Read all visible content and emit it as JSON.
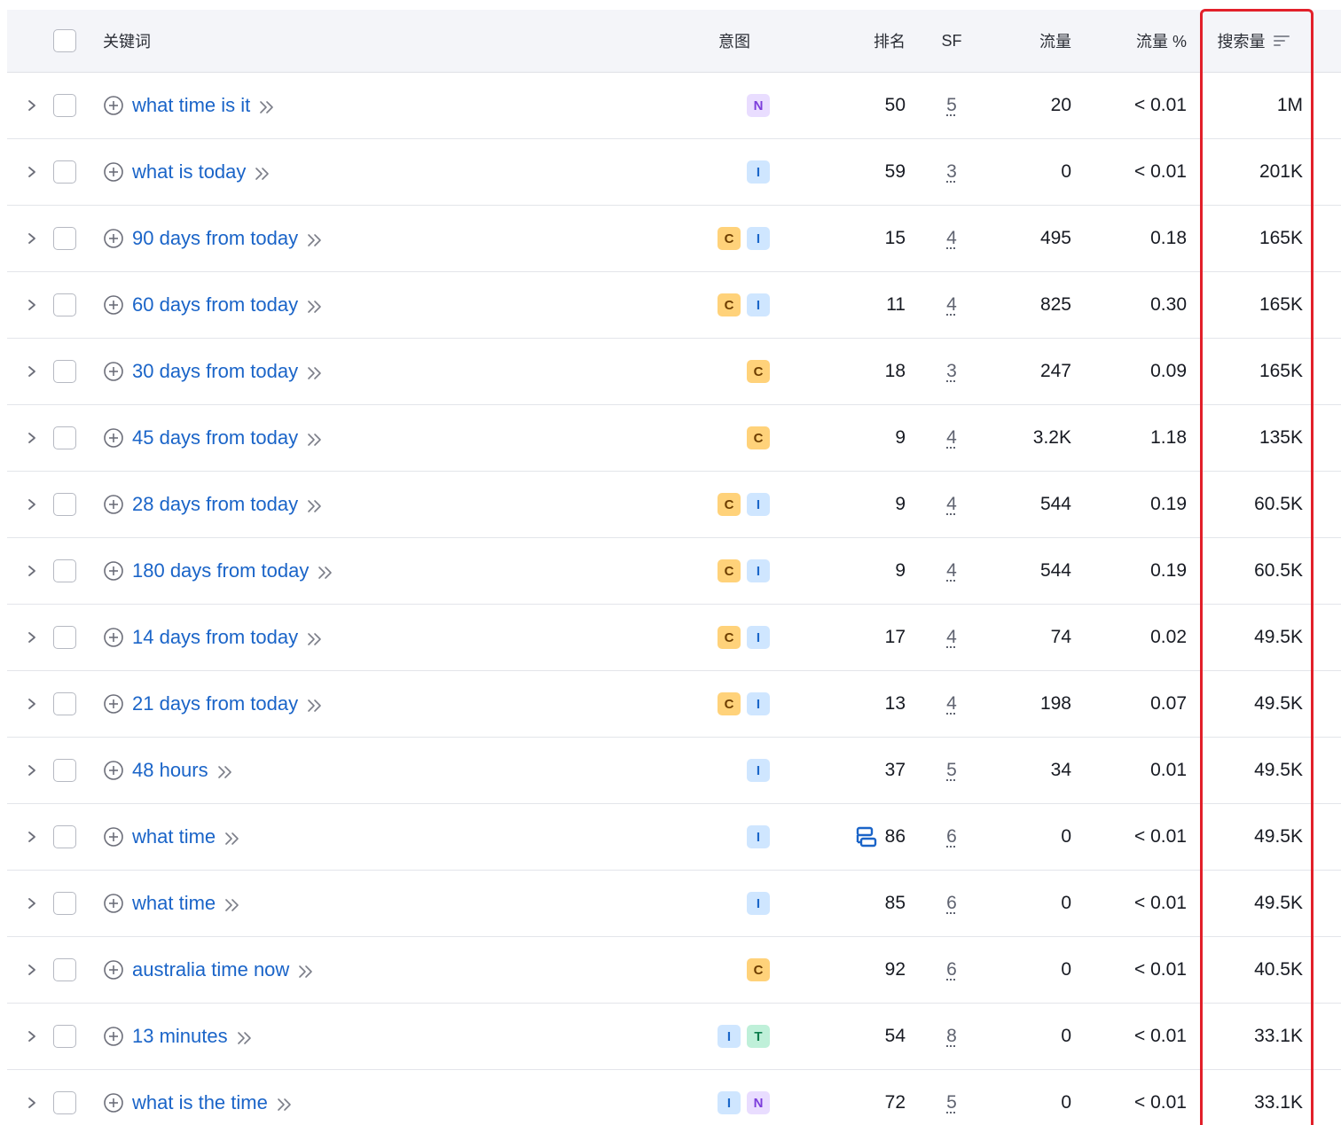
{
  "header": {
    "keyword": "关键词",
    "intent": "意图",
    "position": "排名",
    "sf": "SF",
    "traffic": "流量",
    "traffic_pct": "流量 %",
    "volume": "搜索量"
  },
  "icons": {
    "expand": "chevron-right-icon",
    "add": "plus-circle-icon",
    "open": "double-chevron-right-icon",
    "sort": "sort-descending-icon",
    "feature": "serp-feature-icon"
  },
  "colors": {
    "link": "#1a64c8",
    "highlight": "#e2202a",
    "header_bg": "#f4f5f9"
  },
  "rows": [
    {
      "keyword": "what time is it",
      "intents": [
        "N"
      ],
      "position": "50",
      "sf": "5",
      "traffic": "20",
      "traffic_pct": "< 0.01",
      "volume": "1M",
      "feature": false
    },
    {
      "keyword": "what is today",
      "intents": [
        "I"
      ],
      "position": "59",
      "sf": "3",
      "traffic": "0",
      "traffic_pct": "< 0.01",
      "volume": "201K",
      "feature": false
    },
    {
      "keyword": "90 days from today",
      "intents": [
        "C",
        "I"
      ],
      "position": "15",
      "sf": "4",
      "traffic": "495",
      "traffic_pct": "0.18",
      "volume": "165K",
      "feature": false
    },
    {
      "keyword": "60 days from today",
      "intents": [
        "C",
        "I"
      ],
      "position": "11",
      "sf": "4",
      "traffic": "825",
      "traffic_pct": "0.30",
      "volume": "165K",
      "feature": false
    },
    {
      "keyword": "30 days from today",
      "intents": [
        "C"
      ],
      "position": "18",
      "sf": "3",
      "traffic": "247",
      "traffic_pct": "0.09",
      "volume": "165K",
      "feature": false
    },
    {
      "keyword": "45 days from today",
      "intents": [
        "C"
      ],
      "position": "9",
      "sf": "4",
      "traffic": "3.2K",
      "traffic_pct": "1.18",
      "volume": "135K",
      "feature": false
    },
    {
      "keyword": "28 days from today",
      "intents": [
        "C",
        "I"
      ],
      "position": "9",
      "sf": "4",
      "traffic": "544",
      "traffic_pct": "0.19",
      "volume": "60.5K",
      "feature": false
    },
    {
      "keyword": "180 days from today",
      "intents": [
        "C",
        "I"
      ],
      "position": "9",
      "sf": "4",
      "traffic": "544",
      "traffic_pct": "0.19",
      "volume": "60.5K",
      "feature": false
    },
    {
      "keyword": "14 days from today",
      "intents": [
        "C",
        "I"
      ],
      "position": "17",
      "sf": "4",
      "traffic": "74",
      "traffic_pct": "0.02",
      "volume": "49.5K",
      "feature": false
    },
    {
      "keyword": "21 days from today",
      "intents": [
        "C",
        "I"
      ],
      "position": "13",
      "sf": "4",
      "traffic": "198",
      "traffic_pct": "0.07",
      "volume": "49.5K",
      "feature": false
    },
    {
      "keyword": "48 hours",
      "intents": [
        "I"
      ],
      "position": "37",
      "sf": "5",
      "traffic": "34",
      "traffic_pct": "0.01",
      "volume": "49.5K",
      "feature": false
    },
    {
      "keyword": "what time",
      "intents": [
        "I"
      ],
      "position": "86",
      "sf": "6",
      "traffic": "0",
      "traffic_pct": "< 0.01",
      "volume": "49.5K",
      "feature": true
    },
    {
      "keyword": "what time",
      "intents": [
        "I"
      ],
      "position": "85",
      "sf": "6",
      "traffic": "0",
      "traffic_pct": "< 0.01",
      "volume": "49.5K",
      "feature": false
    },
    {
      "keyword": "australia time now",
      "intents": [
        "C"
      ],
      "position": "92",
      "sf": "6",
      "traffic": "0",
      "traffic_pct": "< 0.01",
      "volume": "40.5K",
      "feature": false
    },
    {
      "keyword": "13 minutes",
      "intents": [
        "I",
        "T"
      ],
      "position": "54",
      "sf": "8",
      "traffic": "0",
      "traffic_pct": "< 0.01",
      "volume": "33.1K",
      "feature": false
    },
    {
      "keyword": "what is the time",
      "intents": [
        "I",
        "N"
      ],
      "position": "72",
      "sf": "5",
      "traffic": "0",
      "traffic_pct": "< 0.01",
      "volume": "33.1K",
      "feature": false
    }
  ]
}
